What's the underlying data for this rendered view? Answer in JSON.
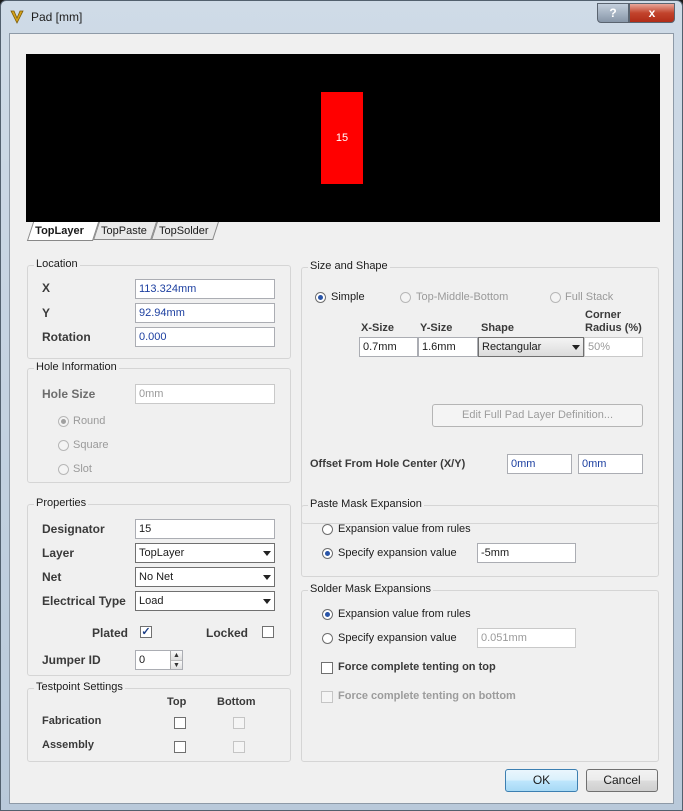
{
  "window": {
    "title": "Pad [mm]",
    "help_label": "?",
    "close_label": "x",
    "icon": "altium-pad-icon"
  },
  "preview": {
    "pad_label": "15",
    "background": "#000000",
    "pad_color": "#ff0000"
  },
  "tabs": [
    {
      "label": "TopLayer",
      "active": true
    },
    {
      "label": "TopPaste",
      "active": false
    },
    {
      "label": "TopSolder",
      "active": false
    }
  ],
  "location": {
    "title": "Location",
    "x_label": "X",
    "x_value": "113.324mm",
    "y_label": "Y",
    "y_value": "92.94mm",
    "rotation_label": "Rotation",
    "rotation_value": "0.000"
  },
  "hole": {
    "title": "Hole Information",
    "size_label": "Hole Size",
    "size_value": "0mm",
    "round_label": "Round",
    "square_label": "Square",
    "slot_label": "Slot"
  },
  "properties": {
    "title": "Properties",
    "designator_label": "Designator",
    "designator_value": "15",
    "layer_label": "Layer",
    "layer_value": "TopLayer",
    "net_label": "Net",
    "net_value": "No Net",
    "electrical_label": "Electrical Type",
    "electrical_value": "Load",
    "plated_label": "Plated",
    "plated_check": "✓",
    "locked_label": "Locked",
    "jumper_label": "Jumper ID",
    "jumper_value": "0"
  },
  "testpoint": {
    "title": "Testpoint Settings",
    "top_label": "Top",
    "bottom_label": "Bottom",
    "fabrication_label": "Fabrication",
    "assembly_label": "Assembly"
  },
  "size_shape": {
    "title": "Size and Shape",
    "simple_label": "Simple",
    "tmb_label": "Top-Middle-Bottom",
    "fullstack_label": "Full Stack",
    "xsize_header": "X-Size",
    "ysize_header": "Y-Size",
    "shape_header": "Shape",
    "corner_header_1": "Corner",
    "corner_header_2": "Radius (%)",
    "xsize_value": "0.7mm",
    "ysize_value": "1.6mm",
    "shape_value": "Rectangular",
    "corner_value": "50%",
    "edit_button": "Edit Full Pad Layer Definition...",
    "offset_label": "Offset From Hole Center (X/Y)",
    "offset_x": "0mm",
    "offset_y": "0mm"
  },
  "paste_mask": {
    "title": "Paste Mask Expansion",
    "rules_label": "Expansion value from rules",
    "specify_label": "Specify expansion value",
    "specify_value": "-5mm"
  },
  "solder_mask": {
    "title": "Solder Mask Expansions",
    "rules_label": "Expansion value from rules",
    "specify_label": "Specify expansion value",
    "specify_value": "0.051mm",
    "tent_top_label": "Force complete tenting on top",
    "tent_bottom_label": "Force complete tenting on bottom"
  },
  "buttons": {
    "ok": "OK",
    "cancel": "Cancel"
  }
}
